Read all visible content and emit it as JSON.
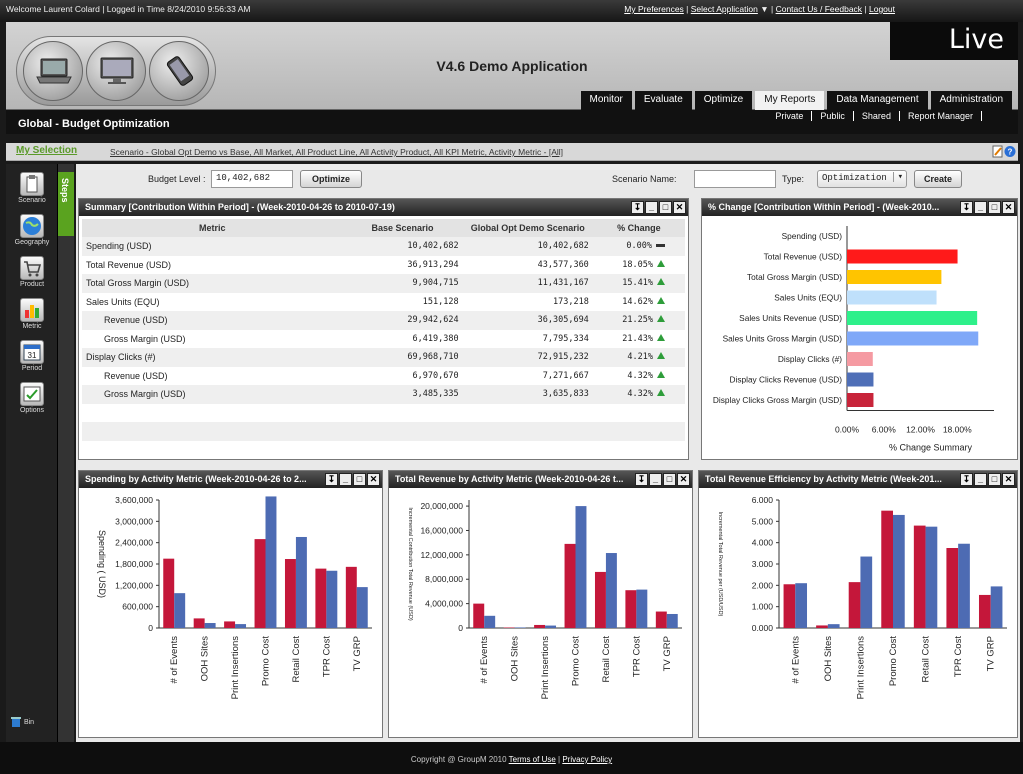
{
  "topbar": {
    "welcome": "Welcome Laurent Colard | Logged in Time 8/24/2010 9:56:33 AM",
    "links": [
      "My Preferences",
      "Select Application",
      "Contact Us / Feedback",
      "Logout"
    ]
  },
  "header": {
    "app_title": "V4.6 Demo Application",
    "live_label": "Live",
    "nav_tabs": [
      "Monitor",
      "Evaluate",
      "Optimize",
      "My Reports",
      "Data Management",
      "Administration"
    ],
    "active_tab": "My Reports"
  },
  "page": {
    "title": "Global - Budget Optimization",
    "subnav": [
      "Private",
      "Public",
      "Shared",
      "Report Manager"
    ]
  },
  "selection": {
    "label": "My Selection",
    "crumbs": "Scenario - Global Opt Demo vs Base, All Market, All Product Line, All Activity Product, All KPI Metric, Activity Metric - [All]"
  },
  "sidebar": {
    "items": [
      "Scenario",
      "Geography",
      "Product",
      "Metric",
      "Period",
      "Options"
    ],
    "bin": "Bin",
    "steps": "Steps"
  },
  "budget": {
    "label": "Budget Level :",
    "value": "10,402,682",
    "optimize_btn": "Optimize",
    "scenario_label": "Scenario Name:",
    "scenario_value": "",
    "type_label": "Type:",
    "type_value": "Optimization",
    "create_btn": "Create"
  },
  "summary": {
    "title": "Summary [Contribution Within Period]  - (Week-2010-04-26 to 2010-07-19)",
    "headers": [
      "Metric",
      "Base Scenario",
      "Global Opt Demo Scenario",
      "% Change"
    ],
    "rows": [
      {
        "metric": "Spending (USD)",
        "base": "10,402,682",
        "opt": "10,402,682",
        "pct": "0.00%",
        "trend": "flat",
        "indent": false
      },
      {
        "metric": "Total Revenue (USD)",
        "base": "36,913,294",
        "opt": "43,577,360",
        "pct": "18.05%",
        "trend": "up",
        "indent": false
      },
      {
        "metric": "Total Gross Margin (USD)",
        "base": "9,904,715",
        "opt": "11,431,167",
        "pct": "15.41%",
        "trend": "up",
        "indent": false
      },
      {
        "metric": "Sales Units (EQU)",
        "base": "151,128",
        "opt": "173,218",
        "pct": "14.62%",
        "trend": "up",
        "indent": false
      },
      {
        "metric": "Revenue (USD)",
        "base": "29,942,624",
        "opt": "36,305,694",
        "pct": "21.25%",
        "trend": "up",
        "indent": true
      },
      {
        "metric": "Gross Margin (USD)",
        "base": "6,419,380",
        "opt": "7,795,334",
        "pct": "21.43%",
        "trend": "up",
        "indent": true
      },
      {
        "metric": "Display Clicks (#)",
        "base": "69,968,710",
        "opt": "72,915,232",
        "pct": "4.21%",
        "trend": "up",
        "indent": false
      },
      {
        "metric": "Revenue (USD)",
        "base": "6,970,670",
        "opt": "7,271,667",
        "pct": "4.32%",
        "trend": "up",
        "indent": true
      },
      {
        "metric": "Gross Margin (USD)",
        "base": "3,485,335",
        "opt": "3,635,833",
        "pct": "4.32%",
        "trend": "up",
        "indent": true
      }
    ]
  },
  "chart_data": [
    {
      "type": "bar",
      "orientation": "horizontal",
      "title": "% Change  [Contribution Within Period]  - (Week-2010...",
      "categories": [
        "Spending (USD)",
        "Total Revenue (USD)",
        "Total Gross Margin (USD)",
        "Sales Units (EQU)",
        "Sales Units Revenue (USD)",
        "Sales Units Gross Margin (USD)",
        "Display Clicks (#)",
        "Display Clicks Revenue (USD)",
        "Display Clicks Gross Margin (USD)"
      ],
      "values": [
        0.0,
        18.05,
        15.41,
        14.62,
        21.25,
        21.43,
        4.21,
        4.32,
        4.32
      ],
      "colors": [
        "#cccccc",
        "#ff1a1a",
        "#ffc400",
        "#bfe0fb",
        "#2ef08a",
        "#7fa8f8",
        "#f59aa2",
        "#4f6fb7",
        "#c8243a"
      ],
      "xlabel": "% Change Summary",
      "ticks": [
        "0.00%",
        "6.00%",
        "12.00%",
        "18.00%"
      ],
      "xlim": [
        0,
        24
      ]
    },
    {
      "type": "bar",
      "title": "Spending by Activity Metric (Week-2010-04-26 to 2...",
      "categories": [
        "# of Events",
        "OOH Sites",
        "Print Insertions",
        "Promo Cost",
        "Retail Cost",
        "TPR Cost",
        "TV GRP"
      ],
      "series": [
        {
          "values": [
            1950000,
            270000,
            185000,
            2500000,
            1940000,
            1670000,
            1720000
          ],
          "color": "#c4173a"
        },
        {
          "values": [
            980000,
            140000,
            110000,
            3700000,
            2560000,
            1610000,
            1150000
          ],
          "color": "#4d6bb3"
        }
      ],
      "ylabel": "Spending ( USD)",
      "yticks": [
        "0",
        "600,000",
        "1,200,000",
        "1,800,000",
        "2,400,000",
        "3,000,000",
        "3,600,000"
      ],
      "ylim": [
        0,
        3600000
      ]
    },
    {
      "type": "bar",
      "title": "Total Revenue by Activity Metric (Week-2010-04-26 t...",
      "categories": [
        "# of Events",
        "OOH Sites",
        "Print Insertions",
        "Promo Cost",
        "Retail Cost",
        "TPR Cost",
        "TV GRP"
      ],
      "series": [
        {
          "values": [
            4000000,
            80000,
            500000,
            13800000,
            9200000,
            6200000,
            2700000
          ],
          "color": "#c4173a"
        },
        {
          "values": [
            2000000,
            90000,
            400000,
            20000000,
            12300000,
            6300000,
            2300000
          ],
          "color": "#4d6bb3"
        }
      ],
      "ylabel": "Incremental Contribution Total Revenue (USD)",
      "yticks": [
        "0",
        "4,000,000",
        "8,000,000",
        "12,000,000",
        "16,000,000",
        "20,000,000"
      ],
      "ylim": [
        0,
        21000000
      ]
    },
    {
      "type": "bar",
      "title": "Total Revenue Efficiency by Activity Metric (Week-201...",
      "categories": [
        "# of Events",
        "OOH Sites",
        "Print Insertions",
        "Promo Cost",
        "Retail Cost",
        "TPR Cost",
        "TV GRP"
      ],
      "series": [
        {
          "values": [
            2.05,
            0.12,
            2.15,
            5.5,
            4.8,
            3.75,
            1.55
          ],
          "color": "#c4173a"
        },
        {
          "values": [
            2.1,
            0.18,
            3.35,
            5.3,
            4.75,
            3.95,
            1.95
          ],
          "color": "#4d6bb3"
        }
      ],
      "ylabel": "Incremental Total Revenue per (USD/USD)",
      "yticks": [
        "0.000",
        "1.000",
        "2.000",
        "3.000",
        "4.000",
        "5.000",
        "6.000"
      ],
      "ylim": [
        0,
        6
      ]
    }
  ],
  "footer": {
    "copyright": "Copyright @ GroupM 2010",
    "terms": "Terms of Use",
    "privacy": "Privacy Policy"
  }
}
